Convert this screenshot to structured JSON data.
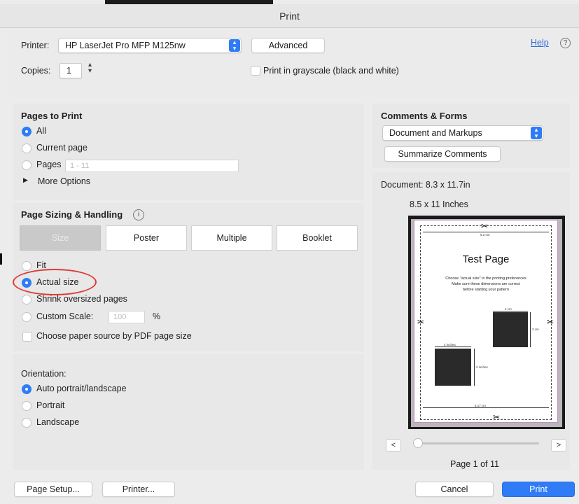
{
  "window": {
    "title": "Print"
  },
  "printer": {
    "label": "Printer:",
    "selected": "HP LaserJet Pro MFP M125nw",
    "advanced_label": "Advanced",
    "help_label": "Help",
    "help_icon": "?"
  },
  "copies": {
    "label": "Copies:",
    "value": "1",
    "grayscale_label": "Print in grayscale (black and white)"
  },
  "pages_to_print": {
    "heading": "Pages to Print",
    "options": [
      {
        "label": "All",
        "selected": true
      },
      {
        "label": "Current page",
        "selected": false
      },
      {
        "label": "Pages",
        "selected": false
      }
    ],
    "pages_placeholder": "1 - 11",
    "more_options_label": "More Options"
  },
  "page_sizing": {
    "heading": "Page Sizing & Handling",
    "info_icon": "i",
    "tabs": [
      {
        "label": "Size",
        "active": true
      },
      {
        "label": "Poster",
        "active": false
      },
      {
        "label": "Multiple",
        "active": false
      },
      {
        "label": "Booklet",
        "active": false
      }
    ],
    "options": [
      {
        "label": "Fit",
        "selected": false
      },
      {
        "label": "Actual size",
        "selected": true
      },
      {
        "label": "Shrink oversized pages",
        "selected": false
      },
      {
        "label": "Custom Scale:",
        "selected": false
      }
    ],
    "custom_scale_value": "100",
    "percent_label": "%",
    "paper_source_label": "Choose paper source by PDF page size"
  },
  "orientation": {
    "heading": "Orientation:",
    "options": [
      {
        "label": "Auto portrait/landscape",
        "selected": true
      },
      {
        "label": "Portrait",
        "selected": false
      },
      {
        "label": "Landscape",
        "selected": false
      }
    ]
  },
  "comments_forms": {
    "heading": "Comments & Forms",
    "selected": "Document and Markups",
    "summarize_label": "Summarize Comments"
  },
  "preview": {
    "document_size": "Document: 8.3 x 11.7in",
    "paper_size": "8.5 x 11 Inches",
    "test_page": {
      "title": "Test Page",
      "lines": [
        "Choose \"actual size\" in the printing preferences",
        "Make sure these dimensions are correct",
        "before starting your pattern"
      ],
      "dim_top": "6.2 cm",
      "dim_bottom": "6.17 cm",
      "dim_square_top": "4 cm",
      "dim_square_side": "3 cm",
      "dim_square2_top": "2 inches",
      "dim_square2_side": "2 inches"
    },
    "prev_label": "<",
    "next_label": ">",
    "page_indicator": "Page 1 of 11"
  },
  "footer": {
    "page_setup_label": "Page Setup...",
    "printer_label": "Printer...",
    "cancel_label": "Cancel",
    "print_label": "Print"
  },
  "colors": {
    "accent": "#2f7cf6",
    "annotation": "#e13a33"
  }
}
